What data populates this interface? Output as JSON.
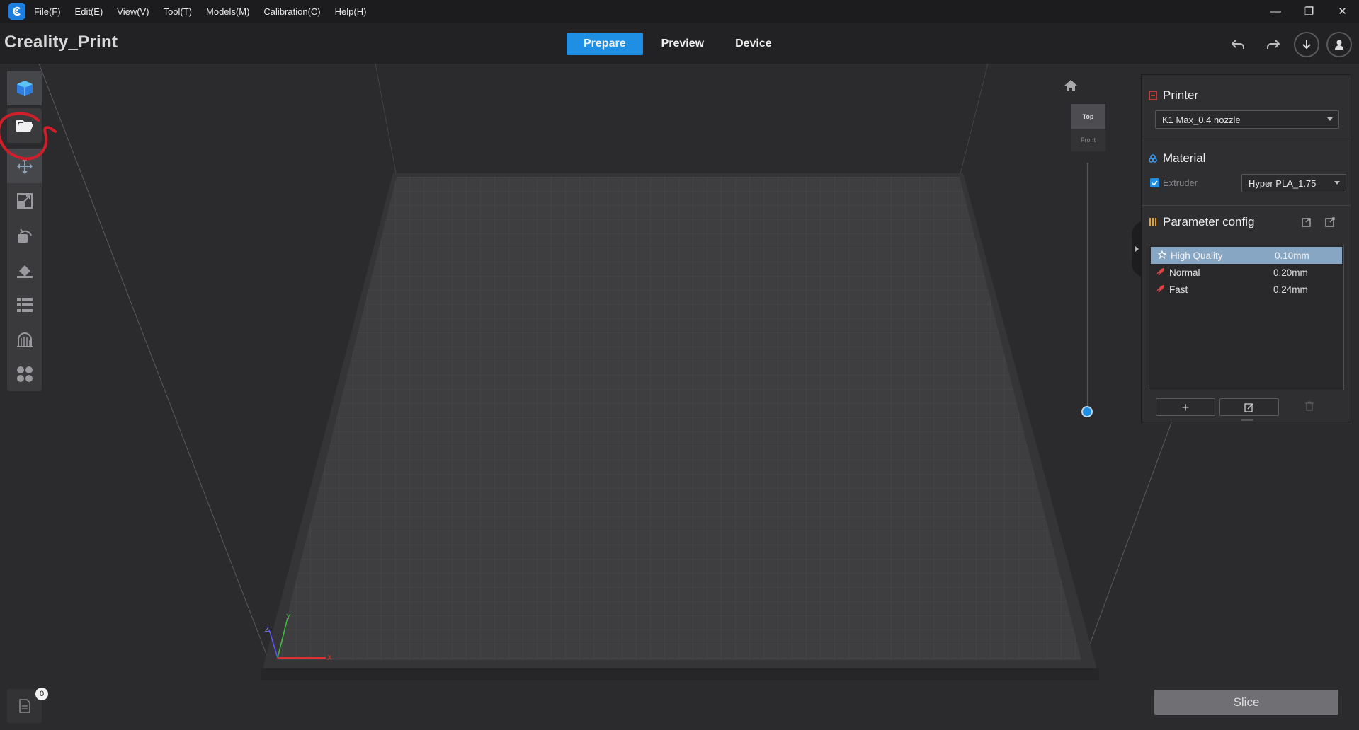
{
  "menu": {
    "items": [
      "File(F)",
      "Edit(E)",
      "View(V)",
      "Tool(T)",
      "Models(M)",
      "Calibration(C)",
      "Help(H)"
    ]
  },
  "window_controls": {
    "minimize": "—",
    "restore": "❐",
    "close": "✕"
  },
  "app": {
    "title": "Creality_Print"
  },
  "modes": {
    "prepare": "Prepare",
    "preview": "Preview",
    "device": "Device",
    "active": "Prepare"
  },
  "view_cube": {
    "top": "Top",
    "front": "Front"
  },
  "axes": {
    "x": "X",
    "y": "Y",
    "z": "Z"
  },
  "left_tools": [
    {
      "name": "add-model-icon"
    },
    {
      "name": "open-folder-icon"
    },
    {
      "name": "move-icon"
    },
    {
      "name": "scale-icon"
    },
    {
      "name": "rotate-icon"
    },
    {
      "name": "lay-flat-icon"
    },
    {
      "name": "object-list-icon"
    },
    {
      "name": "support-icon"
    },
    {
      "name": "arrange-icon"
    }
  ],
  "panel": {
    "printer": {
      "title": "Printer",
      "selected": "K1 Max_0.4 nozzle"
    },
    "material": {
      "title": "Material",
      "extruder_label": "Extruder",
      "extruder_checked": true,
      "selected": "Hyper PLA_1.75"
    },
    "parameter": {
      "title": "Parameter config",
      "profiles": [
        {
          "name": "High Quality",
          "value": "0.10mm",
          "selected": true
        },
        {
          "name": "Normal",
          "value": "0.20mm",
          "selected": false
        },
        {
          "name": "Fast",
          "value": "0.24mm",
          "selected": false
        }
      ],
      "add_label": "+"
    }
  },
  "bottom": {
    "object_count": "0",
    "slice_label": "Slice"
  },
  "colors": {
    "accent": "#1e8fe3",
    "annotation": "#d01f2a",
    "axis_x": "#e03030",
    "axis_y": "#40c040",
    "axis_z": "#5a5aff"
  }
}
